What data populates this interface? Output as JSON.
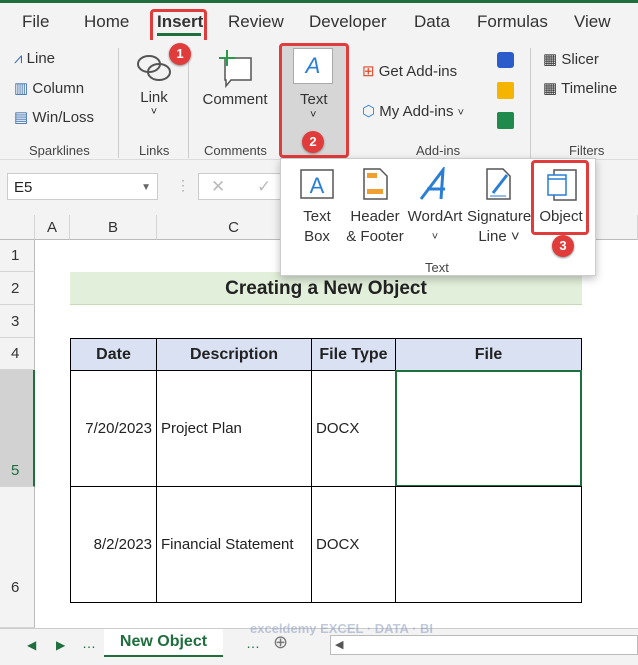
{
  "tabs": [
    "File",
    "Home",
    "Insert",
    "Review",
    "Developer",
    "Data",
    "Formulas",
    "View"
  ],
  "ribbon": {
    "sparklines": {
      "items": [
        "Line",
        "Column",
        "Win/Loss"
      ],
      "label": "Sparklines"
    },
    "links": {
      "item": "Link",
      "label": "Links"
    },
    "comments": {
      "item": "Comment",
      "label": "Comments"
    },
    "text": {
      "item": "Text"
    },
    "addins": {
      "get": "Get Add-ins",
      "my": "My Add-ins",
      "label": "Add-ins"
    },
    "filters": {
      "items": [
        "Slicer",
        "Timeline"
      ],
      "label": "Filters"
    }
  },
  "badges": [
    "1",
    "2",
    "3"
  ],
  "namebox": "E5",
  "popup": {
    "items": [
      [
        "Text",
        "Box"
      ],
      [
        "Header",
        "& Footer"
      ],
      [
        "WordArt",
        "˅"
      ],
      [
        "Signature",
        "Line ˅"
      ],
      [
        "Object",
        ""
      ]
    ],
    "label": "Text"
  },
  "columns": [
    "A",
    "B",
    "C"
  ],
  "rows": [
    "1",
    "2",
    "3",
    "4",
    "5",
    "6"
  ],
  "sheet": {
    "title": "Creating a New Object",
    "headers": [
      "Date",
      "Description",
      "File Type",
      "File"
    ],
    "data": [
      [
        "7/20/2023",
        "Project Plan",
        "DOCX",
        ""
      ],
      [
        "8/2/2023",
        "Financial Statement",
        "DOCX",
        ""
      ]
    ]
  },
  "sheettab": "New Object",
  "watermark": "exceldemy EXCEL · DATA · BI",
  "colors": {
    "accent": "#1e6e3e",
    "highlight": "#e03c3c",
    "header_fill": "#d9e1f2",
    "title_fill": "#e2efda"
  }
}
